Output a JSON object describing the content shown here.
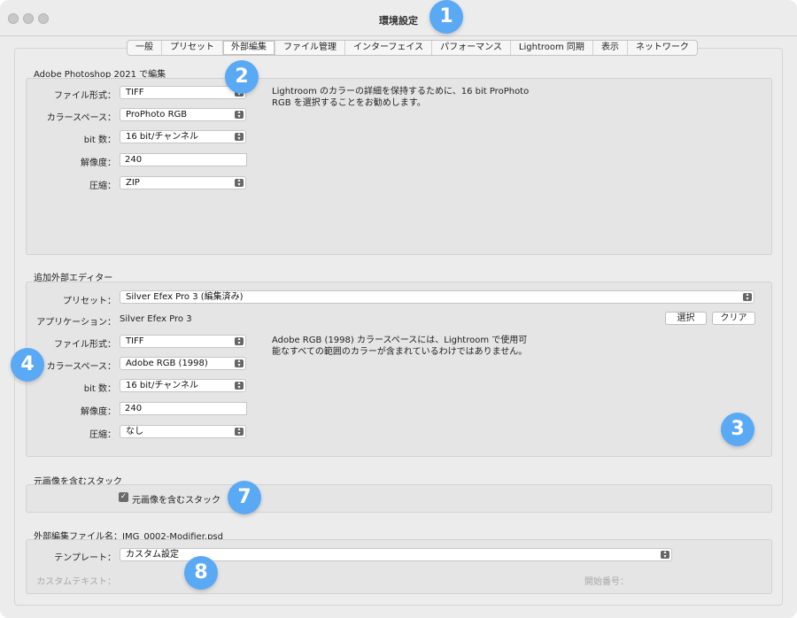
{
  "window": {
    "title": "環境設定"
  },
  "tabs": [
    {
      "label": "一般"
    },
    {
      "label": "プリセット"
    },
    {
      "label": "外部編集",
      "active": true
    },
    {
      "label": "ファイル管理"
    },
    {
      "label": "インターフェイス"
    },
    {
      "label": "パフォーマンス"
    },
    {
      "label": "Lightroom 同期"
    },
    {
      "label": "表示"
    },
    {
      "label": "ネットワーク"
    }
  ],
  "photoshop": {
    "heading": "Adobe Photoshop 2021 で編集",
    "file_format_label": "ファイル形式：",
    "file_format": "TIFF",
    "color_space_label": "カラースペース：",
    "color_space": "ProPhoto RGB",
    "bit_depth_label": "bit 数：",
    "bit_depth": "16 bit/チャンネル",
    "resolution_label": "解像度：",
    "resolution": "240",
    "compression_label": "圧縮：",
    "compression": "ZIP",
    "note_line1": "Lightroom のカラーの詳細を保持するために、16 bit ProPhoto",
    "note_line2": "RGB を選択することをお勧めします。"
  },
  "additional": {
    "heading": "追加外部エディター",
    "preset_label": "プリセット：",
    "preset": "Silver Efex Pro 3 (編集済み)",
    "app_label": "アプリケーション：",
    "app": "Silver Efex Pro 3",
    "choose_button": "選択",
    "clear_button": "クリア",
    "file_format_label": "ファイル形式：",
    "file_format": "TIFF",
    "color_space_label": "カラースペース：",
    "color_space": "Adobe RGB (1998)",
    "bit_depth_label": "bit 数：",
    "bit_depth": "16 bit/チャンネル",
    "resolution_label": "解像度：",
    "resolution": "240",
    "compression_label": "圧縮：",
    "compression": "なし",
    "note_line1": "Adobe RGB (1998) カラースペースには、Lightroom で使用可",
    "note_line2": "能なすべての範囲のカラーが含まれているわけではありません。"
  },
  "stack": {
    "heading": "元画像を含むスタック",
    "checkbox_label": "元画像を含むスタック",
    "checkbox_mark": "✓",
    "checked": true
  },
  "naming": {
    "heading": "外部編集ファイル名：IMG_0002-Modifier.psd",
    "template_label": "テンプレート：",
    "template": "カスタム設定",
    "custom_text_label": "カスタムテキスト：",
    "start_number_label": "開始番号："
  },
  "badges": [
    "1",
    "2",
    "3",
    "4",
    "7",
    "8"
  ],
  "colors": {
    "badge": "#5aa9f5",
    "window_bg": "#ececec",
    "panel_bg": "#e5e5e5"
  }
}
